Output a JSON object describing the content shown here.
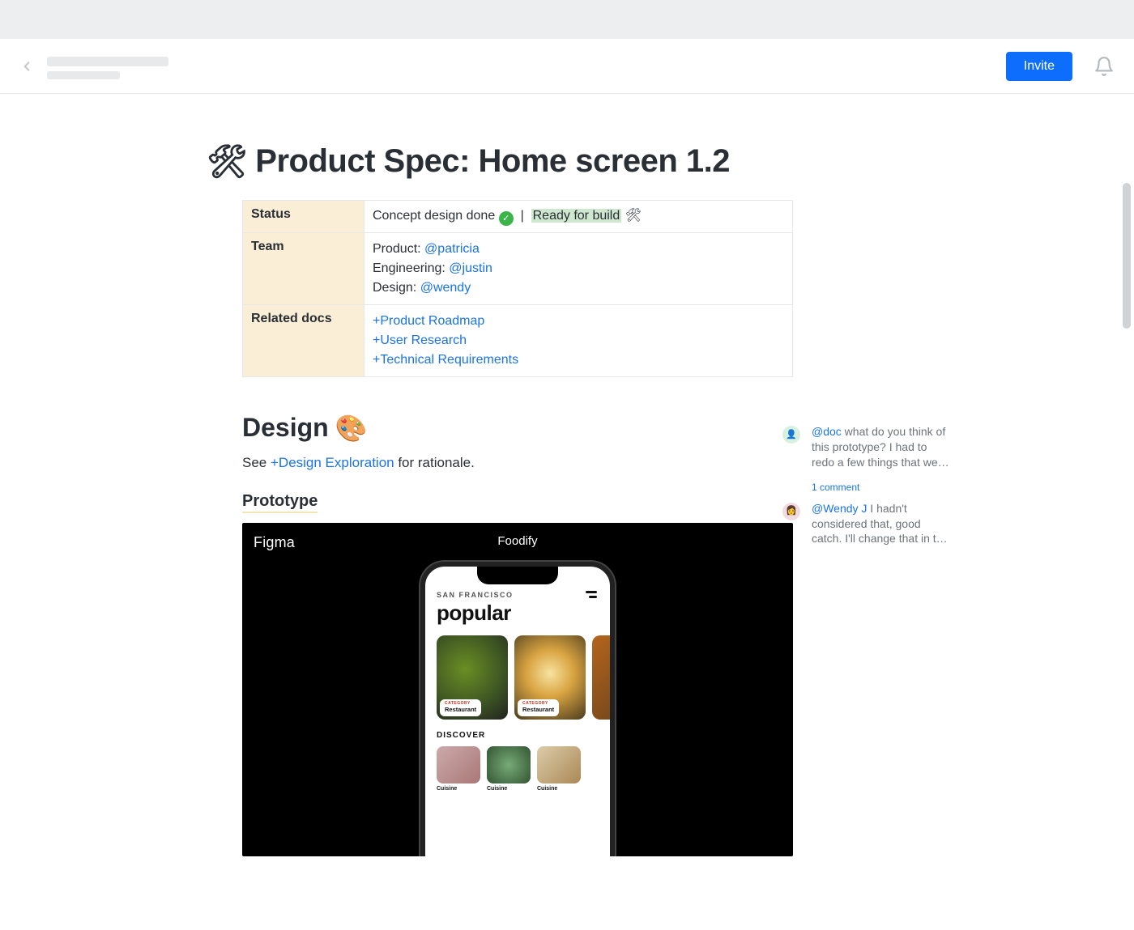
{
  "header": {
    "invite_label": "Invite"
  },
  "page": {
    "title_icon": "🛠",
    "title": "Product Spec: Home screen 1.2"
  },
  "info_table": {
    "rows": {
      "status": {
        "label": "Status",
        "text_before": "Concept design done",
        "separator": "|",
        "highlighted": "Ready for build",
        "trailing_icon": "🛠"
      },
      "team": {
        "label": "Team",
        "lines": [
          {
            "role": "Product:",
            "mention": "@patricia"
          },
          {
            "role": "Engineering:",
            "mention": "@justin"
          },
          {
            "role": "Design:",
            "mention": "@wendy"
          }
        ]
      },
      "related": {
        "label": "Related docs",
        "links": [
          "+Product Roadmap",
          "+User Research",
          "+Technical Requirements"
        ]
      }
    }
  },
  "design_section": {
    "heading": "Design",
    "heading_icon": "🎨",
    "see_prefix": "See ",
    "see_link": "+Design Exploration",
    "see_suffix": " for rationale.",
    "prototype_heading": "Prototype"
  },
  "figma": {
    "logo": "Figma",
    "title": "Foodify",
    "phone": {
      "city": "SAN FRANCISCO",
      "heading": "popular",
      "card_category": "CATEGORY",
      "card_label": "Restaurant",
      "discover": "DISCOVER",
      "mini_label": "Cuisine"
    }
  },
  "comments": {
    "thread1": {
      "mention": "@doc",
      "text": " what do you think of this prototype? I had to redo a few things that we…",
      "meta": "1 comment"
    },
    "thread2": {
      "mention": "@Wendy J",
      "text": " I hadn't considered that, good catch. I'll change that in t…"
    }
  }
}
